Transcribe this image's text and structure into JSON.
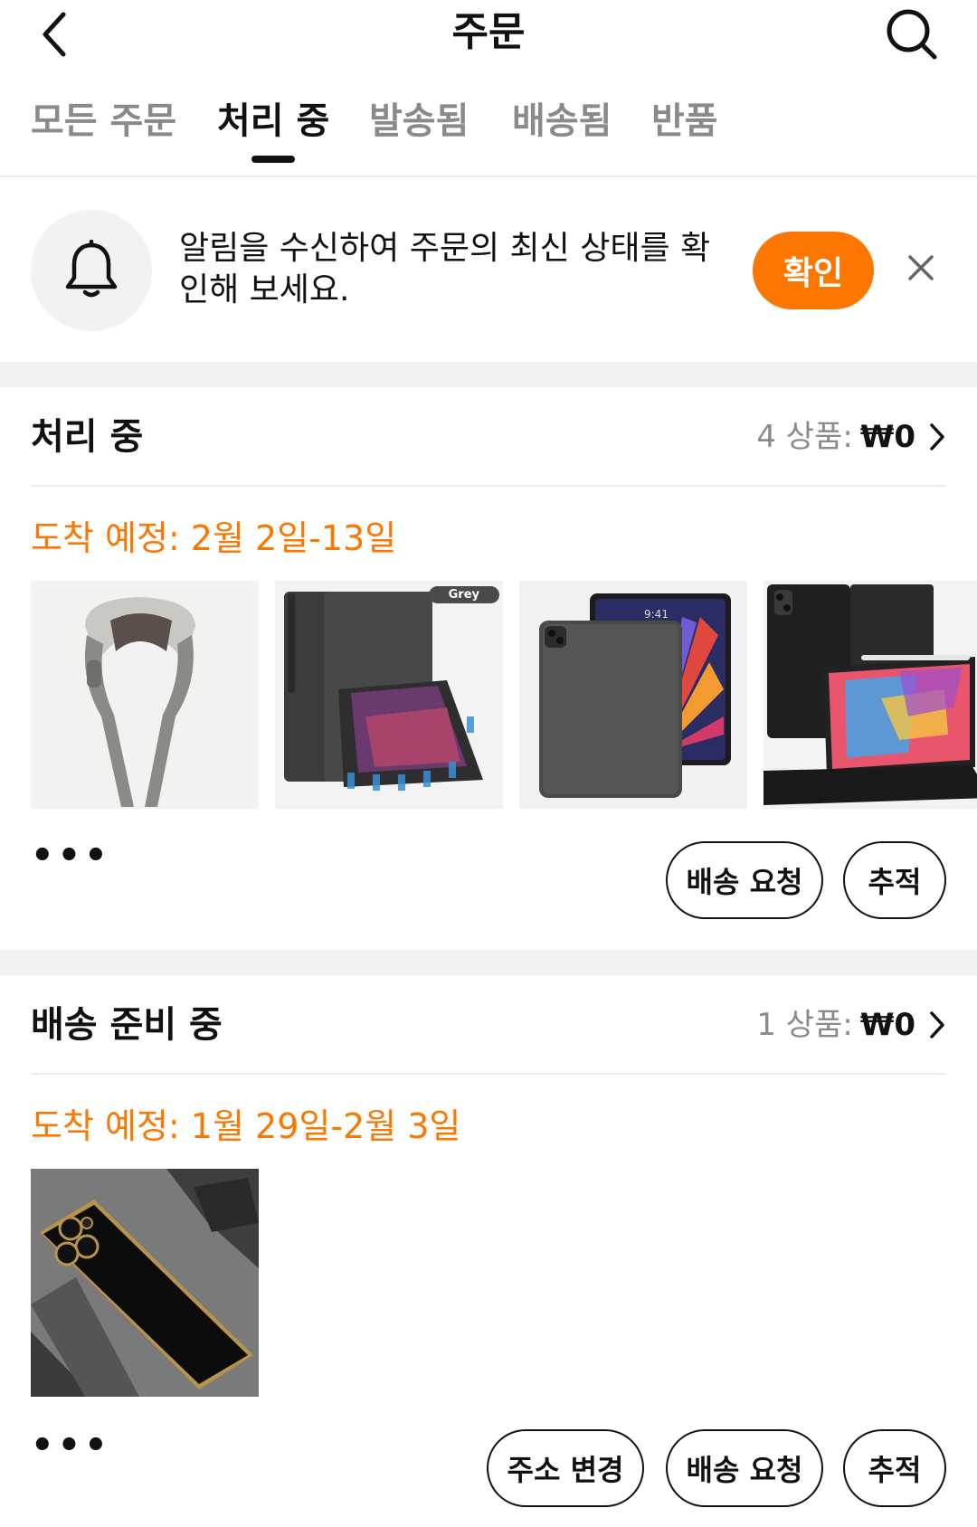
{
  "header": {
    "title": "주문",
    "back_icon": "chevron-left-icon",
    "search_icon": "search-icon"
  },
  "tabs": [
    {
      "label": "모든 주문",
      "active": false
    },
    {
      "label": "처리 중",
      "active": true
    },
    {
      "label": "발송됨",
      "active": false
    },
    {
      "label": "배송됨",
      "active": false
    },
    {
      "label": "반품",
      "active": false
    }
  ],
  "notify": {
    "text": "알림을 수신하여 주문의 최신 상태를 확인해 보세요.",
    "confirm_label": "확인",
    "bell_icon": "bell-icon",
    "close_icon": "close-icon"
  },
  "sections": [
    {
      "title": "처리 중",
      "count": "4 상품:",
      "price": "₩0",
      "eta": "도착 예정: 2월 2일-13일",
      "products": [
        "neck-massager",
        "tablet-case-magnetic",
        "tablet-case-back",
        "tablet-keyboard-case"
      ],
      "thumb_badge": "Grey",
      "thumb_time": "9:41",
      "more": "•••",
      "buttons": [
        "배송 요청",
        "추적"
      ]
    },
    {
      "title": "배송 준비 중",
      "count": "1 상품:",
      "price": "₩0",
      "eta": "도착 예정: 1월 29일-2월 3일",
      "products": [
        "phone-case-black-gold"
      ],
      "more": "•••",
      "buttons": [
        "주소 변경",
        "배송 요청",
        "추적"
      ]
    }
  ],
  "colors": {
    "accent": "#fb7701",
    "text": "#111111",
    "muted": "#8a8a8a",
    "band": "#f2f2f2"
  }
}
